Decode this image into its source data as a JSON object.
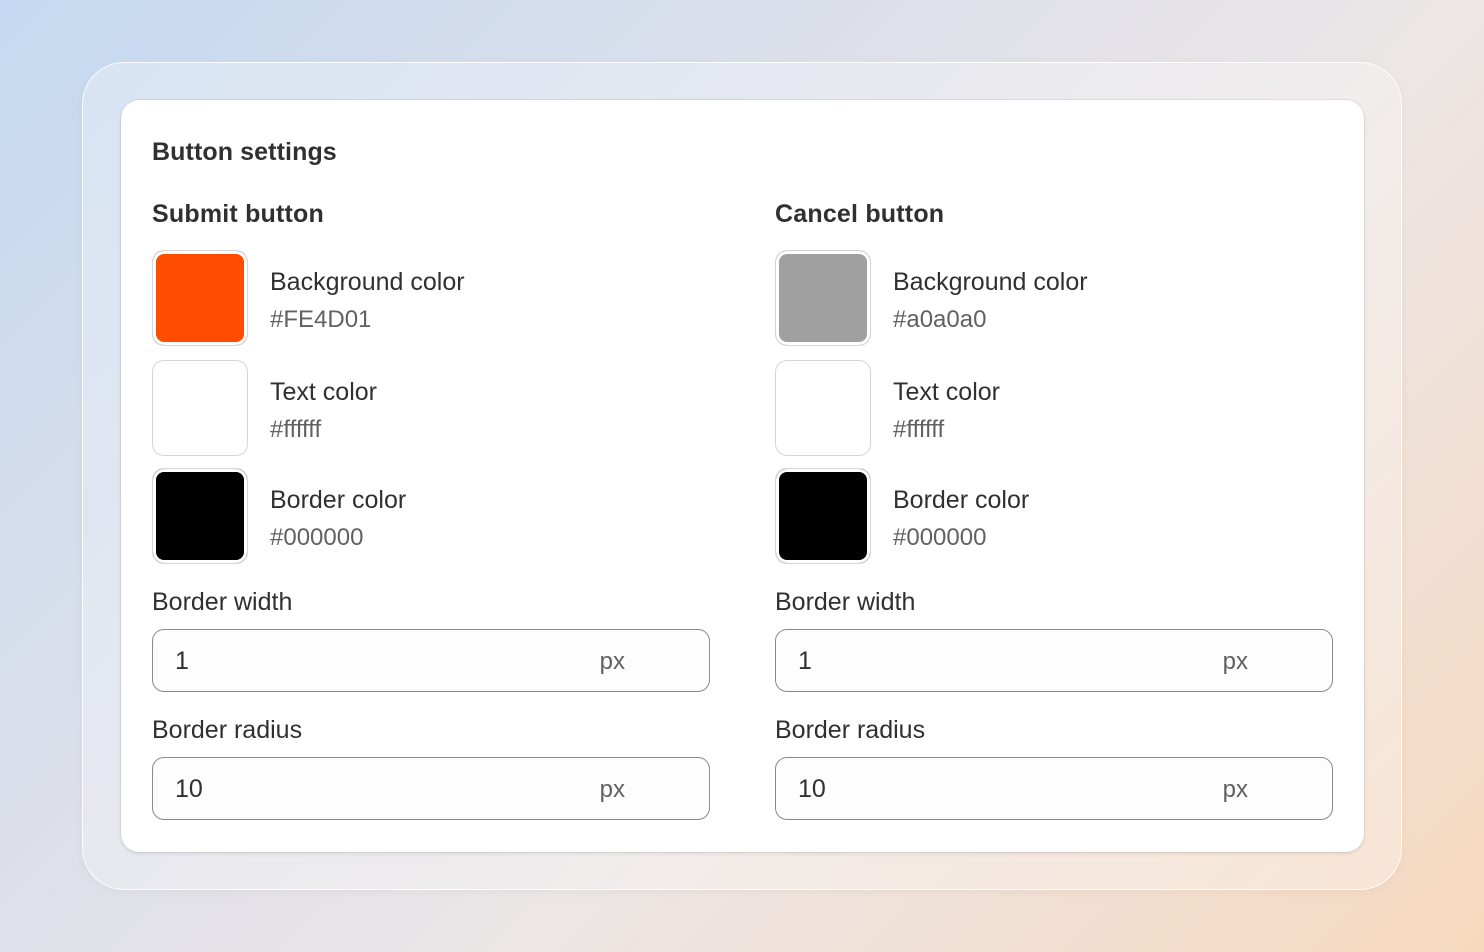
{
  "card": {
    "title": "Button settings"
  },
  "submit": {
    "heading": "Submit button",
    "swatches": [
      {
        "label": "Background color",
        "value": "#FE4D01",
        "color": "#fe4d01"
      },
      {
        "label": "Text color",
        "value": "#ffffff",
        "color": "#ffffff"
      },
      {
        "label": "Border color",
        "value": "#000000",
        "color": "#000000"
      }
    ],
    "border_width": {
      "label": "Border width",
      "value": "1",
      "unit": "px"
    },
    "border_radius": {
      "label": "Border radius",
      "value": "10",
      "unit": "px"
    }
  },
  "cancel": {
    "heading": "Cancel button",
    "swatches": [
      {
        "label": "Background color",
        "value": "#a0a0a0",
        "color": "#a0a0a0"
      },
      {
        "label": "Text color",
        "value": "#ffffff",
        "color": "#ffffff"
      },
      {
        "label": "Border color",
        "value": "#000000",
        "color": "#000000"
      }
    ],
    "border_width": {
      "label": "Border width",
      "value": "1",
      "unit": "px"
    },
    "border_radius": {
      "label": "Border radius",
      "value": "10",
      "unit": "px"
    }
  }
}
